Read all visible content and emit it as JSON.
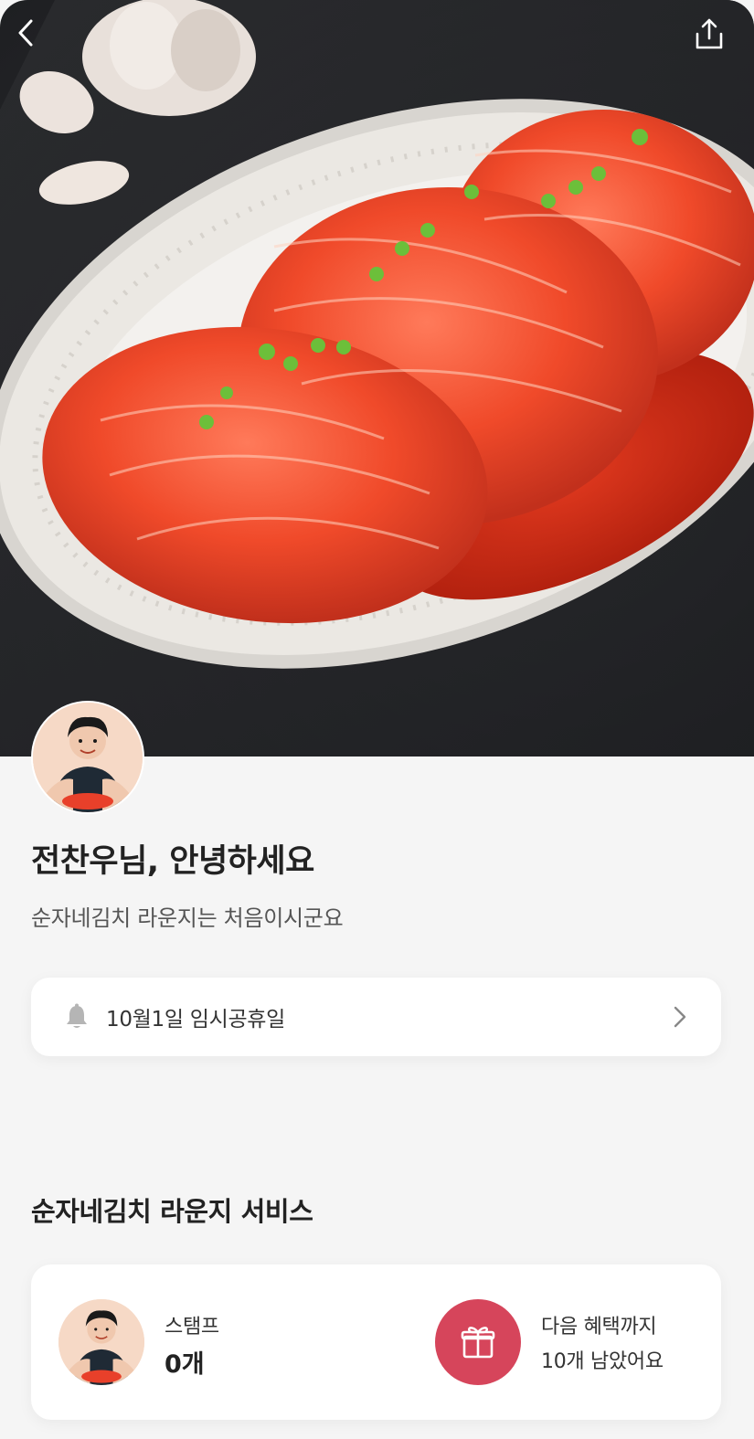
{
  "hero": {
    "image": "kimchi-platter-photo",
    "back_icon": "chevron-left-icon",
    "share_icon": "share-icon"
  },
  "profile": {
    "avatar": "store-owner-avatar",
    "greeting": "전찬우님, 안녕하세요",
    "subtext": "순자네김치 라운지는 처음이시군요"
  },
  "notice": {
    "icon": "bell-icon",
    "text": "10월1일 임시공휴일",
    "chevron": "chevron-right-icon"
  },
  "services": {
    "title": "순자네김치 라운지 서비스",
    "stamp": {
      "label": "스탬프",
      "count": "0개"
    },
    "next_benefit": {
      "icon": "gift-icon",
      "line1": "다음 혜택까지",
      "line2": "10개 남았어요",
      "color": "#d6455b"
    }
  }
}
